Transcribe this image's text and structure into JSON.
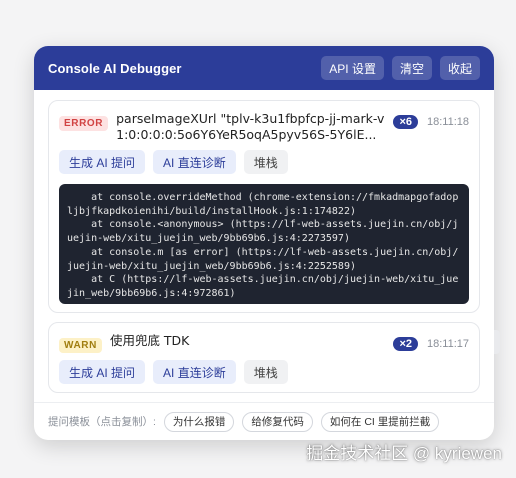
{
  "header": {
    "title": "Console AI Debugger",
    "buttons": {
      "api_settings": "API 设置",
      "clear": "清空",
      "collapse": "收起"
    }
  },
  "entries": [
    {
      "level": "ERROR",
      "message": "parseImageXUrl \"tplv-k3u1fbpfcp-jj-mark-v1:0:0:0:0:5o6Y6YeR5oqA5pyv56S-5Y6lE...",
      "count": "×6",
      "time": "18:11:18",
      "actions": {
        "generate_prompt": "生成 AI 提问",
        "diagnose": "AI 直连诊断",
        "stack": "堆栈"
      },
      "stack_trace": "    at console.overrideMethod (chrome-extension://fmkadmapgofadopljbjfkapdkoienihi/build/installHook.js:1:174822)\n    at console.<anonymous> (https://lf-web-assets.juejin.cn/obj/juejin-web/xitu_juejin_web/9bb69b6.js:4:2273597)\n    at console.m [as error] (https://lf-web-assets.juejin.cn/obj/juejin-web/xitu_juejin_web/9bb69b6.js:4:2252589)\n    at C (https://lf-web-assets.juejin.cn/obj/juejin-web/xitu_juejin_web/9bb69b6.js:4:972861)"
    },
    {
      "level": "WARN",
      "message": "使用兜底 TDK",
      "count": "×2",
      "time": "18:11:17",
      "actions": {
        "generate_prompt": "生成 AI 提问",
        "diagnose": "AI 直连诊断",
        "stack": "堆栈"
      }
    }
  ],
  "footer": {
    "label": "提问模板（点击复制）:",
    "templates": [
      "为什么报错",
      "给修复代码",
      "如何在 CI 里提前拦截"
    ]
  },
  "watermark": "掘金技术社区 @ kyriewen",
  "colors": {
    "primary": "#2c3d99",
    "error": "#d14343",
    "warn": "#a07d10"
  }
}
